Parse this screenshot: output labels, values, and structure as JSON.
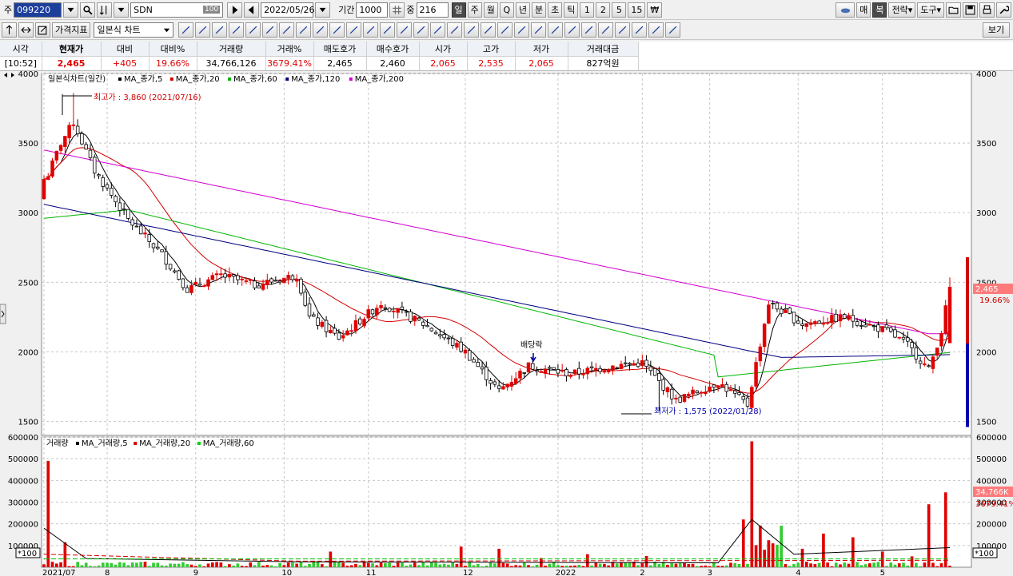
{
  "toolbar1": {
    "market": "주",
    "code": "099220",
    "name": "SDN",
    "name_badge": "100",
    "date": "2022/05/26",
    "period_label": "기간",
    "period_value": "1000",
    "amount_label": "중",
    "amount_value": "216",
    "timeframes": [
      "일",
      "주",
      "월",
      "Q",
      "년",
      "분",
      "초",
      "틱",
      "1",
      "2",
      "5",
      "15",
      "₩"
    ],
    "active_timeframe": "일",
    "right_buttons": [
      "매",
      "복",
      "전략",
      "도구"
    ]
  },
  "toolbar2": {
    "index_tab": "가격지표",
    "chart_type": "일본식 차트",
    "view_button": "보기"
  },
  "quote": {
    "headers": [
      "시각",
      "현재가",
      "대비",
      "대비%",
      "거래량",
      "거래%",
      "매도호가",
      "매수호가",
      "시가",
      "고가",
      "저가",
      "거래대금"
    ],
    "values": [
      "[10:52]",
      "2,465",
      "+405",
      "19.66%",
      "34,766,126",
      "3679.41%",
      "2,465",
      "2,460",
      "2,065",
      "2,535",
      "2,065",
      "827억원"
    ]
  },
  "price_legend": {
    "title": "일본식차트(일간)",
    "items": [
      {
        "label": "MA_종가,5",
        "color": "#000000"
      },
      {
        "label": "MA_종가,20",
        "color": "#d20000"
      },
      {
        "label": "MA_종가,60",
        "color": "#00b400"
      },
      {
        "label": "MA_종가,120",
        "color": "#00007f"
      },
      {
        "label": "MA_종가,200",
        "color": "#d200d2"
      }
    ]
  },
  "volume_legend": {
    "title": "거래량",
    "items": [
      {
        "label": "MA_거래량,5",
        "color": "#000000"
      },
      {
        "label": "MA_거래량,20",
        "color": "#d20000"
      },
      {
        "label": "MA_거래량,60",
        "color": "#00d200"
      }
    ]
  },
  "annotations": {
    "high": "최고가 : 3,860 (2021/07/16)",
    "low": "최저가 : 1,575 (2022/01/28)",
    "dividend": "배당락"
  },
  "price_tag": {
    "price": "2,465",
    "pct": "19.66%"
  },
  "volume_tag": {
    "value": "34,766K",
    "pct": "3679.41%"
  },
  "volume_unit": "*100",
  "chart_data": {
    "type": "candlestick",
    "price_axis": {
      "min": 1400,
      "max": 4000,
      "ticks": [
        1500,
        2000,
        2500,
        3000,
        3500,
        4000
      ]
    },
    "volume_axis": {
      "min": 0,
      "max": 600000,
      "ticks": [
        100000,
        200000,
        300000,
        400000,
        500000,
        600000
      ]
    },
    "x_labels": [
      "2021/07",
      "8",
      "9",
      "10",
      "11",
      "12",
      "2022",
      "2",
      "3",
      "4",
      "5"
    ],
    "first_candle": {
      "open": 3100,
      "high": 3260,
      "low": 3060,
      "close": 3240
    },
    "last_candle": {
      "open": 2065,
      "high": 2535,
      "low": 2065,
      "close": 2465
    },
    "high_point": {
      "date": "2021/07/16",
      "price": 3860
    },
    "low_point": {
      "date": "2022/01/28",
      "price": 1575
    }
  },
  "colors": {
    "up": "#e00000",
    "down": "#0000b0",
    "grid": "#c8c8c8"
  }
}
